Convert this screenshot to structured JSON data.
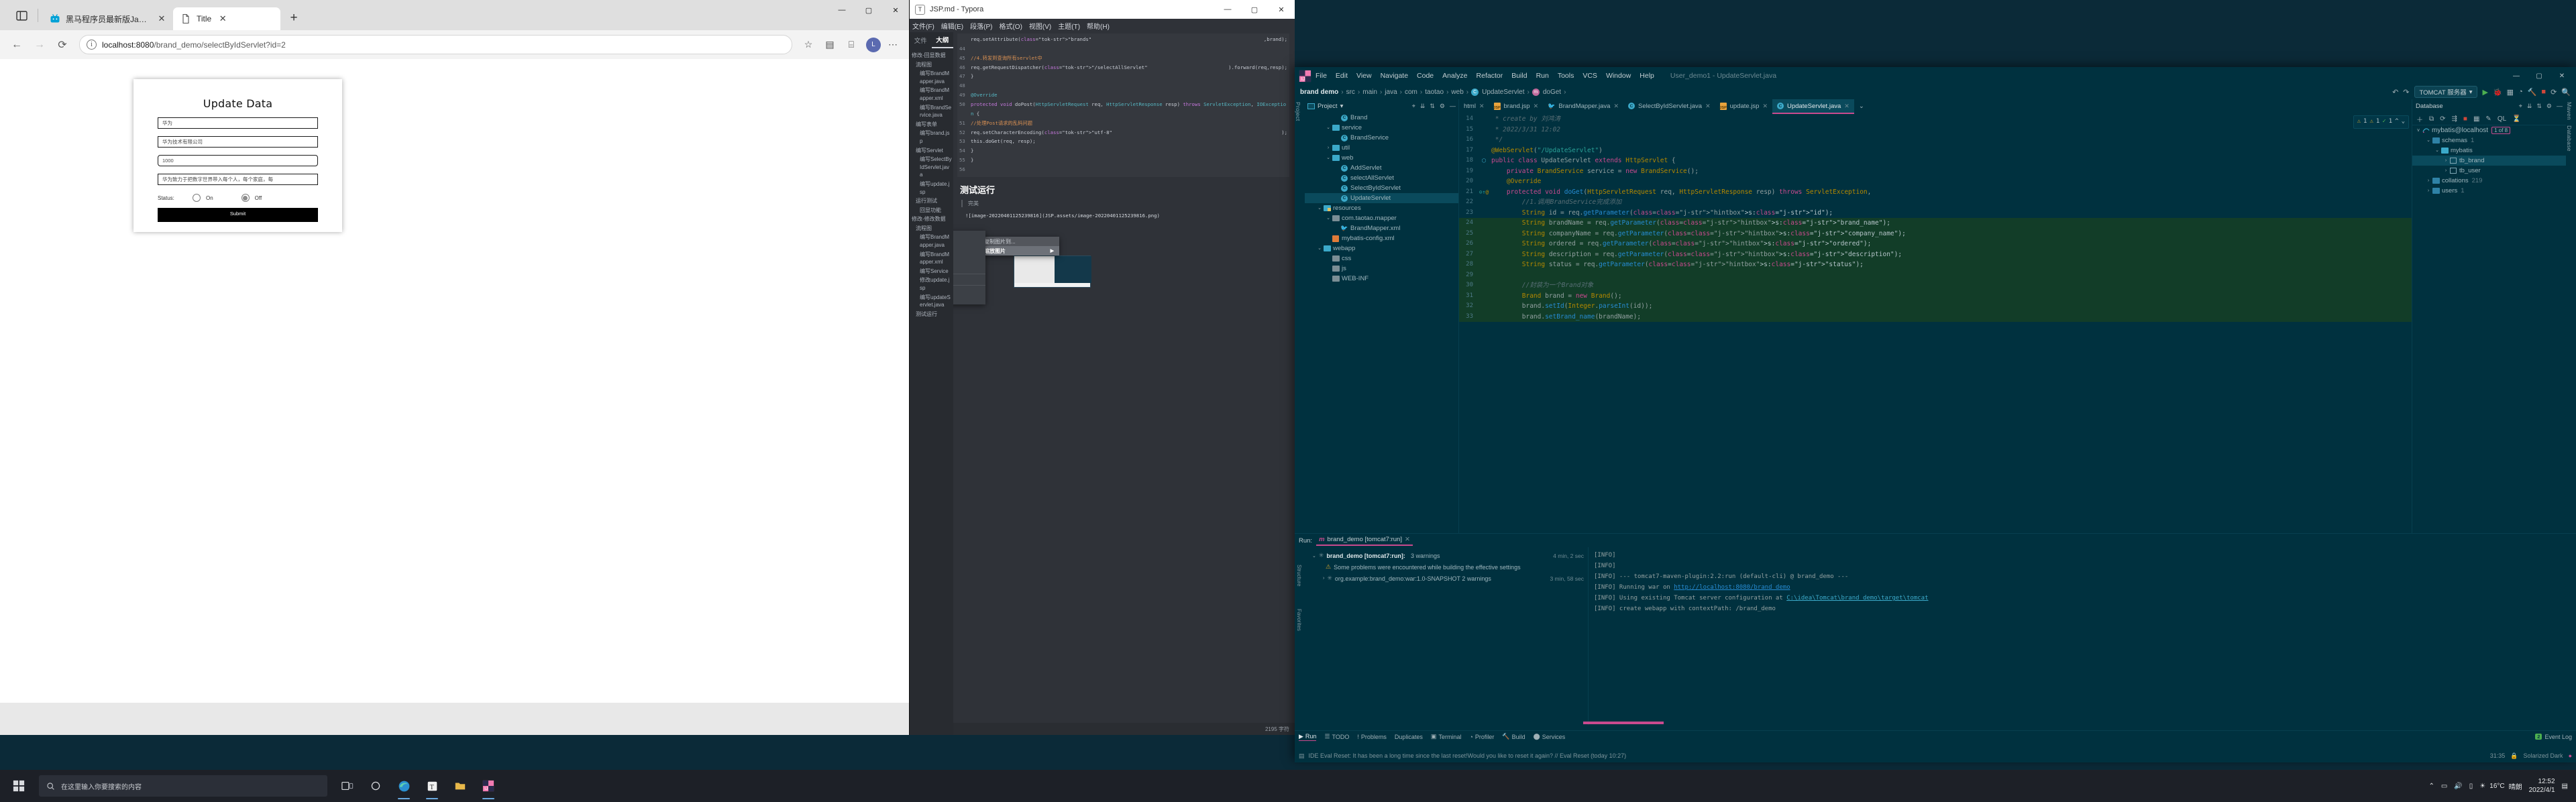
{
  "browser": {
    "tabs": [
      {
        "title": "黑马程序员最新版JavaWeb基础",
        "favicon": "bilibili-icon",
        "active": false
      },
      {
        "title": "Title",
        "favicon": "page-icon",
        "active": true
      }
    ],
    "new_tab_label": "+",
    "nav": {
      "back": "←",
      "forward": "→",
      "reload": "⟳"
    },
    "url_host": "localhost:8080",
    "url_path": "/brand_demo/selectByIdServlet?id=2",
    "window_buttons": {
      "minimize": "―",
      "maximize": "▢",
      "close": "✕"
    }
  },
  "page": {
    "title": "Update Data",
    "fields": [
      {
        "name": "brand-name",
        "value": "华为",
        "rounded": false
      },
      {
        "name": "company-name",
        "value": "华为技术有限公司",
        "rounded": false
      },
      {
        "name": "ordered",
        "value": "1000",
        "rounded": true
      },
      {
        "name": "description",
        "value": "华为致力于把数字世界带入每个人，每个家庭，每",
        "rounded": false
      }
    ],
    "status_label": "Status:",
    "radios": [
      {
        "label": "On",
        "checked": false
      },
      {
        "label": "Off",
        "checked": true
      }
    ],
    "submit_label": "Submit"
  },
  "typora": {
    "window_title": "JSP.md - Typora",
    "app_icon": "T",
    "menu": [
      "文件(F)",
      "编辑(E)",
      "段落(P)",
      "格式(O)",
      "视图(V)",
      "主题(T)",
      "帮助(H)"
    ],
    "side_tabs": [
      {
        "label": "文件",
        "active": false
      },
      {
        "label": "大纲",
        "active": true
      }
    ],
    "outline": [
      {
        "level": 1,
        "label": "修改-回显数据"
      },
      {
        "level": 2,
        "label": "流程图"
      },
      {
        "level": 3,
        "label": "编写BrandMapper.java"
      },
      {
        "level": 3,
        "label": "编写BrandMapper.xml"
      },
      {
        "level": 3,
        "label": "编写BrandService.java"
      },
      {
        "level": 2,
        "label": "编写表单"
      },
      {
        "level": 3,
        "label": "编写brand.jsp"
      },
      {
        "level": 2,
        "label": "编写Servlet"
      },
      {
        "level": 3,
        "label": "编写SelectByIdServlet.java"
      },
      {
        "level": 3,
        "label": "编写update.jsp"
      },
      {
        "level": 2,
        "label": "运行测试"
      },
      {
        "level": 3,
        "label": "回显功能"
      },
      {
        "level": 1,
        "label": "修改-修改数据"
      },
      {
        "level": 2,
        "label": "流程图"
      },
      {
        "level": 3,
        "label": "编写BrandMapper.java"
      },
      {
        "level": 3,
        "label": "编写BrandMapper.xml"
      },
      {
        "level": 3,
        "label": "编写Service"
      },
      {
        "level": 3,
        "label": "修改update.jsp"
      },
      {
        "level": 3,
        "label": "编写updateServlet.java"
      },
      {
        "level": 2,
        "label": "测试运行"
      }
    ],
    "code_lines": [
      {
        "no": "",
        "text": "req.setAttribute(\"brands\",brand);"
      },
      {
        "no": "44",
        "text": ""
      },
      {
        "no": "45",
        "text": "//4.转发到查询所有servlet中"
      },
      {
        "no": "46",
        "text": "req.getRequestDispatcher(\"/selectAllServlet\").forward(req,resp);"
      },
      {
        "no": "47",
        "text": "}"
      },
      {
        "no": "48",
        "text": ""
      },
      {
        "no": "49",
        "text": "@Override"
      },
      {
        "no": "50",
        "text": "protected void doPost(HttpServletRequest req, HttpServletResponse resp) throws ServletException, IOException {"
      },
      {
        "no": "51",
        "text": "//处理Post请求的乱码问题"
      },
      {
        "no": "52",
        "text": "req.setCharacterEncoding(\"utf-8\");"
      },
      {
        "no": "53",
        "text": "this.doGet(req, resp);"
      },
      {
        "no": "54",
        "text": "}"
      },
      {
        "no": "55",
        "text": "}"
      },
      {
        "no": "56",
        "text": ""
      }
    ],
    "heading": "测试运行",
    "quote": "完美",
    "image_markdown": "![image-20220401125239816](JSP.assets/image-20220401125239816.png)",
    "context_menu": [
      {
        "label": "复制图片到...",
        "selected": false,
        "submenu": false
      },
      {
        "label": "缩放图片",
        "selected": true,
        "submenu": true
      }
    ],
    "zoom_options": [
      "25%",
      "33%",
      "50%",
      "67%",
      "80%",
      "100%",
      "150%",
      "200%"
    ],
    "status_left": "",
    "status_right": "2195 字符"
  },
  "idea": {
    "menu": [
      "File",
      "Edit",
      "View",
      "Navigate",
      "Code",
      "Analyze",
      "Refactor",
      "Build",
      "Run",
      "Tools",
      "VCS",
      "Window",
      "Help"
    ],
    "window_title": "User_demo1 - UpdateServlet.java",
    "window_buttons": {
      "minimize": "―",
      "maximize": "▢",
      "close": "✕"
    },
    "breadcrumbs": [
      "brand demo",
      "src",
      "main",
      "java",
      "com",
      "taotao",
      "web",
      "UpdateServlet",
      "doGet"
    ],
    "run_config": "TOMCAT 服务器",
    "project_panel": {
      "title": "Project",
      "rail_label": "Project",
      "tree": [
        {
          "indent": 3,
          "arrow": "",
          "icon": "class-icon",
          "label": "Brand",
          "selected": false
        },
        {
          "indent": 2,
          "arrow": "v",
          "icon": "package-icon",
          "label": "service",
          "selected": false
        },
        {
          "indent": 3,
          "arrow": "",
          "icon": "class-icon",
          "label": "BrandService",
          "selected": false
        },
        {
          "indent": 2,
          "arrow": ">",
          "icon": "package-icon",
          "label": "util",
          "selected": false
        },
        {
          "indent": 2,
          "arrow": "v",
          "icon": "package-icon",
          "label": "web",
          "selected": false
        },
        {
          "indent": 3,
          "arrow": "",
          "icon": "class-icon",
          "label": "AddServlet",
          "selected": false
        },
        {
          "indent": 3,
          "arrow": "",
          "icon": "class-icon",
          "label": "selectAllServlet",
          "selected": false
        },
        {
          "indent": 3,
          "arrow": "",
          "icon": "class-icon",
          "label": "SelectByIdServlet",
          "selected": false
        },
        {
          "indent": 3,
          "arrow": "",
          "icon": "class-icon",
          "label": "UpdateServlet",
          "selected": true
        },
        {
          "indent": 1,
          "arrow": "v",
          "icon": "resources-icon",
          "label": "resources",
          "selected": false
        },
        {
          "indent": 2,
          "arrow": "v",
          "icon": "folder-icon",
          "label": "com.taotao.mapper",
          "selected": false
        },
        {
          "indent": 3,
          "arrow": "",
          "icon": "mybatis-icon",
          "label": "BrandMapper.xml",
          "selected": false
        },
        {
          "indent": 2,
          "arrow": "",
          "icon": "xml-icon",
          "label": "mybatis-config.xml",
          "selected": false
        },
        {
          "indent": 1,
          "arrow": "v",
          "icon": "webapp-icon",
          "label": "webapp",
          "selected": false
        },
        {
          "indent": 2,
          "arrow": "",
          "icon": "folder-icon",
          "label": "css",
          "selected": false
        },
        {
          "indent": 2,
          "arrow": "",
          "icon": "folder-icon",
          "label": "js",
          "selected": false
        },
        {
          "indent": 2,
          "arrow": "",
          "icon": "folder-icon",
          "label": "WEB-INF",
          "selected": false
        }
      ]
    },
    "editor_tabs": [
      {
        "label": "html",
        "icon": "html-icon",
        "active": false
      },
      {
        "label": "brand.jsp",
        "icon": "jsp-icon",
        "active": false
      },
      {
        "label": "BrandMapper.java",
        "icon": "mybatis-icon",
        "active": false
      },
      {
        "label": "SelectByIdServlet.java",
        "icon": "class-icon",
        "active": false
      },
      {
        "label": "update.jsp",
        "icon": "jsp-icon",
        "active": false
      },
      {
        "label": "UpdateServlet.java",
        "icon": "class-icon",
        "active": true
      }
    ],
    "inspection": {
      "warnings1": "1",
      "warnings2": "1",
      "ok": "1"
    },
    "code": [
      {
        "no": "14",
        "text": " * create by 刘鸿涛",
        "style": "comment"
      },
      {
        "no": "15",
        "text": " * 2022/3/31 12:02",
        "style": "comment"
      },
      {
        "no": "16",
        "text": " */",
        "style": "comment"
      },
      {
        "no": "17",
        "text": "@WebServlet(\"/UpdateServlet\")",
        "style": "annotation"
      },
      {
        "no": "18",
        "text": "public class UpdateServlet extends HttpServlet {",
        "style": "code",
        "mark": "class"
      },
      {
        "no": "19",
        "text": "    private BrandService service = new BrandService();",
        "style": "code"
      },
      {
        "no": "20",
        "text": "    @Override",
        "style": "annotation"
      },
      {
        "no": "21",
        "text": "    protected void doGet(HttpServletRequest req, HttpServletResponse resp) throws ServletException,",
        "style": "code",
        "mark": "method"
      },
      {
        "no": "22",
        "text": "        //1.调用BrandService完成添加",
        "style": "comment"
      },
      {
        "no": "23",
        "text": "        String id = req.getParameter( s: \"id\");",
        "style": "code"
      },
      {
        "no": "24",
        "text": "        String brandName = req.getParameter( s: \"brand_name\");",
        "style": "code",
        "green": true
      },
      {
        "no": "25",
        "text": "        String companyName = req.getParameter( s: \"company_name\");",
        "style": "code",
        "green": true
      },
      {
        "no": "26",
        "text": "        String ordered = req.getParameter( s: \"ordered\");",
        "style": "code",
        "green": true
      },
      {
        "no": "27",
        "text": "        String description = req.getParameter( s: \"description\");",
        "style": "code",
        "green": true
      },
      {
        "no": "28",
        "text": "        String status = req.getParameter( s: \"status\");",
        "style": "code",
        "green": true
      },
      {
        "no": "29",
        "text": "",
        "style": "code",
        "green": true
      },
      {
        "no": "30",
        "text": "        //封装为一个Brand对象",
        "style": "comment",
        "green": true
      },
      {
        "no": "31",
        "text": "        Brand brand = new Brand();",
        "style": "code",
        "green": true,
        "current": true
      },
      {
        "no": "32",
        "text": "        brand.setId(Integer.parseInt(id));",
        "style": "code",
        "green": true
      },
      {
        "no": "33",
        "text": "        brand.setBrand_name(brandName);",
        "style": "code",
        "green": true
      }
    ],
    "database_panel": {
      "title": "Database",
      "rail_labels": [
        "Maven",
        "Database"
      ],
      "connection": "mybatis@localhost",
      "connection_badge": "1 of 8",
      "tree": [
        {
          "indent": 1,
          "arrow": "v",
          "icon": "folder-icon",
          "label": "schemas",
          "count": "1",
          "selected": false
        },
        {
          "indent": 2,
          "arrow": "v",
          "icon": "schema-icon",
          "label": "mybatis",
          "count": "",
          "selected": false
        },
        {
          "indent": 3,
          "arrow": ">",
          "icon": "table-icon",
          "label": "tb_brand",
          "count": "",
          "selected": true
        },
        {
          "indent": 3,
          "arrow": ">",
          "icon": "table-icon",
          "label": "tb_user",
          "count": "",
          "selected": false
        },
        {
          "indent": 1,
          "arrow": ">",
          "icon": "folder-icon",
          "label": "collations",
          "count": "219",
          "selected": false
        },
        {
          "indent": 1,
          "arrow": ">",
          "icon": "folder-icon",
          "label": "users",
          "count": "1",
          "selected": false
        }
      ]
    },
    "run_panel": {
      "label": "Run:",
      "tab": "brand_demo [tomcat7:run]",
      "tree": [
        {
          "indent": 0,
          "arrow": "v",
          "label": "brand_demo [tomcat7:run]:",
          "extra": "3 warnings",
          "time": "4 min, 2 sec",
          "icon": "gear-icon",
          "bold": true
        },
        {
          "indent": 1,
          "arrow": "",
          "label": "Some problems were encountered while building the effective settings",
          "extra": "",
          "time": "",
          "icon": "warning-icon",
          "bold": false
        },
        {
          "indent": 1,
          "arrow": ">",
          "label": "org.example:brand_demo:war:1.0-SNAPSHOT 2 warnings",
          "extra": "",
          "time": "3 min, 58 sec",
          "icon": "gear-icon",
          "bold": false
        }
      ],
      "log": [
        "[INFO]",
        "[INFO]",
        "[INFO] --- tomcat7-maven-plugin:2.2:run (default-cli) @ brand_demo ---",
        "[INFO] Running war on http://localhost:8080/brand_demo",
        "[INFO] Using existing Tomcat server configuration at C:\\idea\\Tomcat\\brand_demo\\target\\tomcat",
        "[INFO] create webapp with contextPath: /brand_demo"
      ],
      "log_links": {
        "url": "http://localhost:8080/brand_demo",
        "path": "C:\\idea\\Tomcat\\brand_demo\\target\\tomcat"
      }
    },
    "tool_strip": [
      {
        "label": "Run",
        "icon": "play-icon",
        "active": true
      },
      {
        "label": "TODO",
        "icon": "list-icon",
        "active": false
      },
      {
        "label": "Problems",
        "icon": "problems-icon",
        "active": false
      },
      {
        "label": "Duplicates",
        "icon": "",
        "active": false
      },
      {
        "label": "Terminal",
        "icon": "terminal-icon",
        "active": false
      },
      {
        "label": "Profiler",
        "icon": "profiler-icon",
        "active": false
      },
      {
        "label": "Build",
        "icon": "build-icon",
        "active": false
      },
      {
        "label": "Services",
        "icon": "services-icon",
        "active": false
      }
    ],
    "event_log": {
      "count": "2",
      "label": "Event Log"
    },
    "status_message": "IDE Eval Reset: It has been a long time since the last reset!Would you like to reset it again? // Eval Reset (today 10:27)",
    "status_right": {
      "position": "31:35",
      "theme": "Solarized Dark"
    }
  },
  "taskbar": {
    "start_icon": "windows-icon",
    "search_placeholder": "在这里输入你要搜索的内容",
    "apps": [
      {
        "name": "taskview-icon",
        "running": false
      },
      {
        "name": "cortana-icon",
        "running": false
      },
      {
        "name": "edge-icon",
        "running": true
      },
      {
        "name": "typora-icon",
        "running": true
      },
      {
        "name": "explorer-icon",
        "running": false
      },
      {
        "name": "idea-icon",
        "running": true
      }
    ],
    "tray": [
      {
        "name": "chevron-up-icon"
      },
      {
        "name": "network-icon"
      },
      {
        "name": "volume-icon"
      },
      {
        "name": "battery-icon"
      }
    ],
    "weather_temp": "16°C",
    "weather_desc": "晴朗",
    "clock_time": "12:52",
    "clock_date": "2022/4/1",
    "left_clock_time": "12:52",
    "left_clock_date": "2022/4/1"
  },
  "colors": {
    "idea_bg": "#00313f",
    "idea_accent": "#c94a8e",
    "typora_bg": "#2f3238",
    "taskbar_bg": "#1d2027",
    "selection_green": "#123d28"
  }
}
